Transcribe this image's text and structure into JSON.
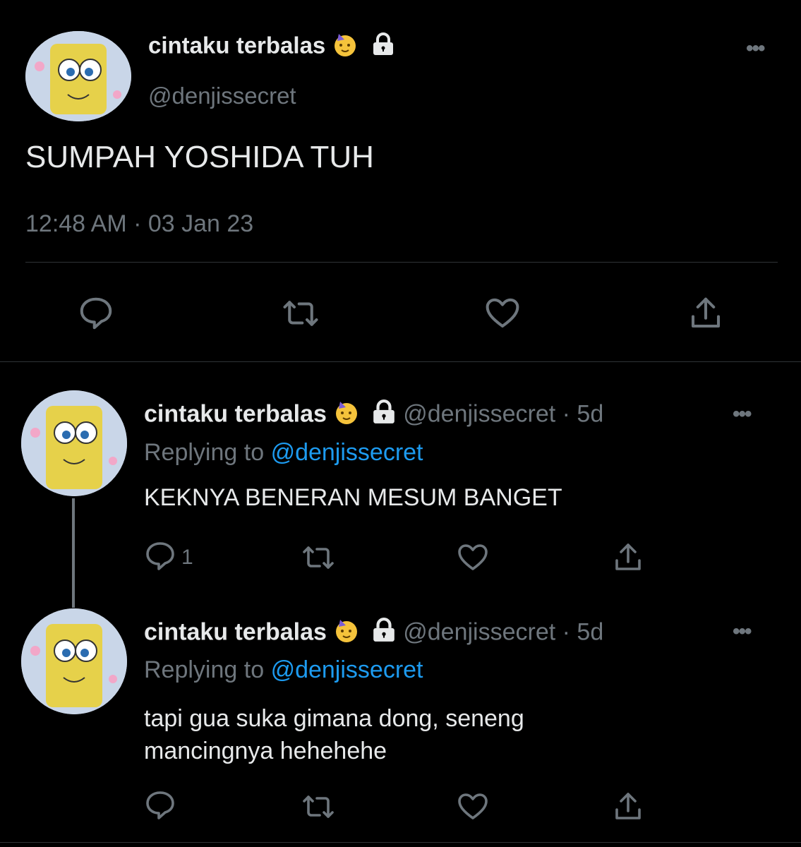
{
  "main_tweet": {
    "display_name": "cintaku terbalas",
    "handle": "@denjissecret",
    "text": "SUMPAH YOSHIDA TUH",
    "timestamp": "12:48 AM · 03 Jan 23",
    "more_label": "•••"
  },
  "replies": [
    {
      "display_name": "cintaku terbalas",
      "handle": "@denjissecret",
      "age": "· 5d",
      "replying_prefix": "Replying to",
      "replying_to": "@denjissecret",
      "text_line1": "KEKNYA BENERAN MESUM BANGET",
      "text_line2": "",
      "reply_count": "1",
      "more_label": "•••"
    },
    {
      "display_name": "cintaku terbalas",
      "handle": "@denjissecret",
      "age": "· 5d",
      "replying_prefix": "Replying to",
      "replying_to": "@denjissecret",
      "text_line1": "tapi gua suka gimana dong, seneng",
      "text_line2": "mancingnya hehehehe",
      "reply_count": "",
      "more_label": "•••"
    }
  ],
  "colors": {
    "background": "#000000",
    "text": "#e7e9ea",
    "muted": "#6e767d",
    "link": "#1d9bf0",
    "divider": "#2f3336"
  },
  "icons": [
    "reply-icon",
    "retweet-icon",
    "like-icon",
    "share-icon",
    "lock-icon",
    "partying-face-emoji",
    "more-icon"
  ]
}
